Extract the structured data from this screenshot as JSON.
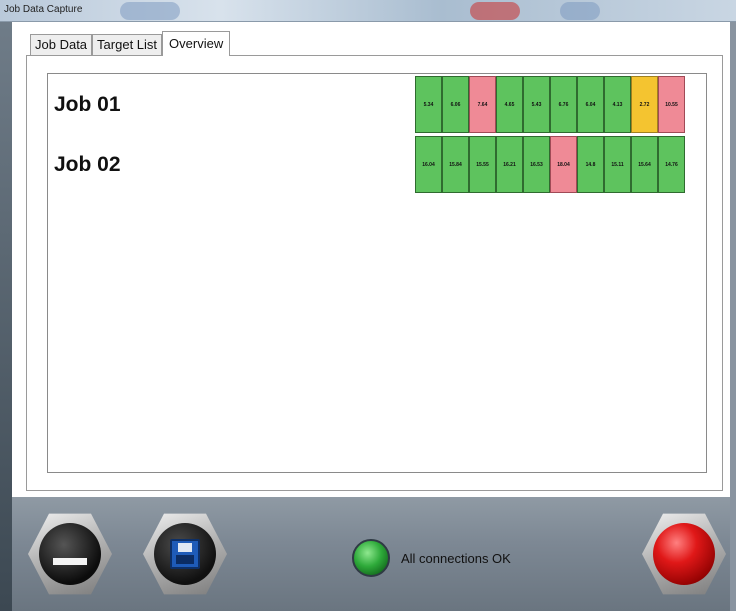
{
  "window": {
    "title": "Job Data Capture"
  },
  "tabs": [
    {
      "label": "Job Data",
      "active": false
    },
    {
      "label": "Target List",
      "active": false
    },
    {
      "label": "Overview",
      "active": true
    }
  ],
  "jobs": [
    {
      "label": "Job 01",
      "cells": [
        {
          "value": "5.34",
          "status": "green"
        },
        {
          "value": "6.06",
          "status": "green"
        },
        {
          "value": "7.64",
          "status": "red"
        },
        {
          "value": "4.65",
          "status": "green"
        },
        {
          "value": "5.43",
          "status": "green"
        },
        {
          "value": "6.76",
          "status": "green"
        },
        {
          "value": "6.04",
          "status": "green"
        },
        {
          "value": "4.13",
          "status": "green"
        },
        {
          "value": "2.72",
          "status": "yellow"
        },
        {
          "value": "10.55",
          "status": "red"
        }
      ]
    },
    {
      "label": "Job 02",
      "cells": [
        {
          "value": "16.04",
          "status": "green"
        },
        {
          "value": "15.84",
          "status": "green"
        },
        {
          "value": "15.55",
          "status": "green"
        },
        {
          "value": "16.21",
          "status": "green"
        },
        {
          "value": "16.53",
          "status": "green"
        },
        {
          "value": "18.04",
          "status": "red"
        },
        {
          "value": "14.8",
          "status": "green"
        },
        {
          "value": "15.11",
          "status": "green"
        },
        {
          "value": "15.64",
          "status": "green"
        },
        {
          "value": "14.76",
          "status": "green"
        }
      ]
    }
  ],
  "status": {
    "text": "All connections OK",
    "led_color": "#2eaa3a"
  },
  "colors": {
    "green": "#5ec35e",
    "red": "#ef8a96",
    "yellow": "#f4c430"
  },
  "buttons": {
    "eject": {
      "icon": "eject-icon"
    },
    "save": {
      "icon": "floppy-disk-icon"
    },
    "stop": {
      "icon": "red-stop-icon"
    }
  }
}
